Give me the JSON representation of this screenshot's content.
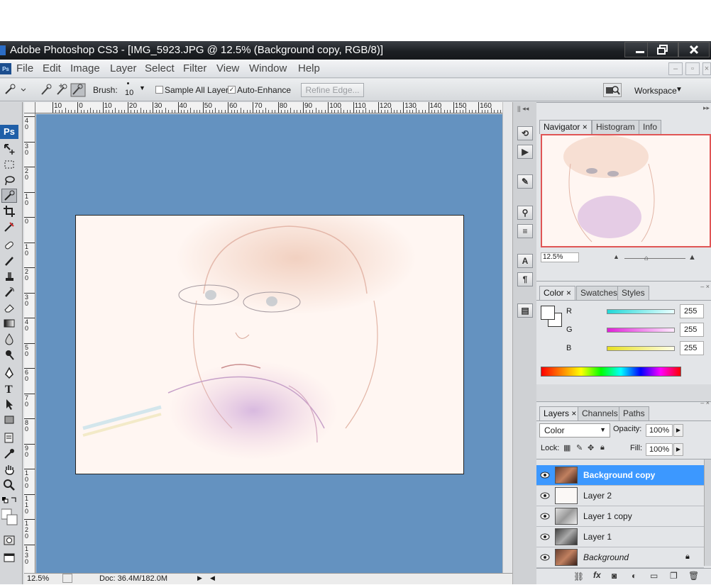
{
  "window": {
    "title": "Adobe Photoshop CS3 - [IMG_5923.JPG @ 12.5% (Background copy, RGB/8)]"
  },
  "menu": [
    "File",
    "Edit",
    "Image",
    "Layer",
    "Select",
    "Filter",
    "View",
    "Window",
    "Help"
  ],
  "options": {
    "brush_label": "Brush:",
    "brush_size": "10",
    "sample_all_layers": "Sample All Layers",
    "sample_all_checked": false,
    "auto_enhance": "Auto-Enhance",
    "auto_enhance_checked": true,
    "refine_edge": "Refine Edge...",
    "workspace": "Workspace"
  },
  "tools_badge": "Ps",
  "ruler": {
    "h_labels": [
      "10",
      "0",
      "10",
      "20",
      "30",
      "40",
      "50",
      "60",
      "70",
      "80",
      "90",
      "100",
      "110",
      "120",
      "130",
      "140",
      "150",
      "160"
    ],
    "v_labels": [
      "40",
      "30",
      "20",
      "10",
      "0",
      "10",
      "20",
      "30",
      "40",
      "50",
      "60",
      "70",
      "80",
      "90",
      "100",
      "110",
      "120",
      "130"
    ]
  },
  "status": {
    "zoom": "12.5%",
    "doc": "Doc: 36.4M/182.0M"
  },
  "navigator": {
    "tabs": [
      "Navigator",
      "Histogram",
      "Info"
    ],
    "zoom": "12.5%"
  },
  "color_panel": {
    "tabs": [
      "Color",
      "Swatches",
      "Styles"
    ],
    "channels": [
      {
        "label": "R",
        "value": "255",
        "color": "#22d8d8"
      },
      {
        "label": "G",
        "value": "255",
        "color": "#e020d8"
      },
      {
        "label": "B",
        "value": "255",
        "color": "#e8e020"
      }
    ]
  },
  "layers_panel": {
    "tabs": [
      "Layers",
      "Channels",
      "Paths"
    ],
    "blend_mode": "Color",
    "opacity_label": "Opacity:",
    "opacity": "100%",
    "lock_label": "Lock:",
    "fill_label": "Fill:",
    "fill": "100%",
    "layers": [
      {
        "name": "Background copy",
        "selected": true
      },
      {
        "name": "Layer 2",
        "selected": false
      },
      {
        "name": "Layer 1 copy",
        "selected": false
      },
      {
        "name": "Layer 1",
        "selected": false
      },
      {
        "name": "Background",
        "selected": false,
        "locked": true
      }
    ]
  },
  "colors": {
    "canvas_bg": "#6492c0",
    "selected_layer": "#3c98ff",
    "titlebar": "#1c1f23"
  }
}
